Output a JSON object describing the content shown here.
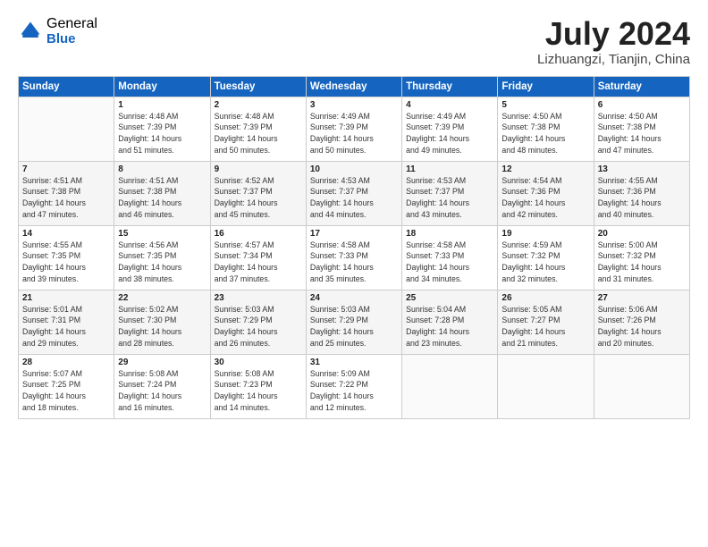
{
  "logo": {
    "general": "General",
    "blue": "Blue"
  },
  "title": "July 2024",
  "subtitle": "Lizhuangzi, Tianjin, China",
  "headers": [
    "Sunday",
    "Monday",
    "Tuesday",
    "Wednesday",
    "Thursday",
    "Friday",
    "Saturday"
  ],
  "weeks": [
    [
      {
        "day": "",
        "info": ""
      },
      {
        "day": "1",
        "info": "Sunrise: 4:48 AM\nSunset: 7:39 PM\nDaylight: 14 hours\nand 51 minutes."
      },
      {
        "day": "2",
        "info": "Sunrise: 4:48 AM\nSunset: 7:39 PM\nDaylight: 14 hours\nand 50 minutes."
      },
      {
        "day": "3",
        "info": "Sunrise: 4:49 AM\nSunset: 7:39 PM\nDaylight: 14 hours\nand 50 minutes."
      },
      {
        "day": "4",
        "info": "Sunrise: 4:49 AM\nSunset: 7:39 PM\nDaylight: 14 hours\nand 49 minutes."
      },
      {
        "day": "5",
        "info": "Sunrise: 4:50 AM\nSunset: 7:38 PM\nDaylight: 14 hours\nand 48 minutes."
      },
      {
        "day": "6",
        "info": "Sunrise: 4:50 AM\nSunset: 7:38 PM\nDaylight: 14 hours\nand 47 minutes."
      }
    ],
    [
      {
        "day": "7",
        "info": "Sunrise: 4:51 AM\nSunset: 7:38 PM\nDaylight: 14 hours\nand 47 minutes."
      },
      {
        "day": "8",
        "info": "Sunrise: 4:51 AM\nSunset: 7:38 PM\nDaylight: 14 hours\nand 46 minutes."
      },
      {
        "day": "9",
        "info": "Sunrise: 4:52 AM\nSunset: 7:37 PM\nDaylight: 14 hours\nand 45 minutes."
      },
      {
        "day": "10",
        "info": "Sunrise: 4:53 AM\nSunset: 7:37 PM\nDaylight: 14 hours\nand 44 minutes."
      },
      {
        "day": "11",
        "info": "Sunrise: 4:53 AM\nSunset: 7:37 PM\nDaylight: 14 hours\nand 43 minutes."
      },
      {
        "day": "12",
        "info": "Sunrise: 4:54 AM\nSunset: 7:36 PM\nDaylight: 14 hours\nand 42 minutes."
      },
      {
        "day": "13",
        "info": "Sunrise: 4:55 AM\nSunset: 7:36 PM\nDaylight: 14 hours\nand 40 minutes."
      }
    ],
    [
      {
        "day": "14",
        "info": "Sunrise: 4:55 AM\nSunset: 7:35 PM\nDaylight: 14 hours\nand 39 minutes."
      },
      {
        "day": "15",
        "info": "Sunrise: 4:56 AM\nSunset: 7:35 PM\nDaylight: 14 hours\nand 38 minutes."
      },
      {
        "day": "16",
        "info": "Sunrise: 4:57 AM\nSunset: 7:34 PM\nDaylight: 14 hours\nand 37 minutes."
      },
      {
        "day": "17",
        "info": "Sunrise: 4:58 AM\nSunset: 7:33 PM\nDaylight: 14 hours\nand 35 minutes."
      },
      {
        "day": "18",
        "info": "Sunrise: 4:58 AM\nSunset: 7:33 PM\nDaylight: 14 hours\nand 34 minutes."
      },
      {
        "day": "19",
        "info": "Sunrise: 4:59 AM\nSunset: 7:32 PM\nDaylight: 14 hours\nand 32 minutes."
      },
      {
        "day": "20",
        "info": "Sunrise: 5:00 AM\nSunset: 7:32 PM\nDaylight: 14 hours\nand 31 minutes."
      }
    ],
    [
      {
        "day": "21",
        "info": "Sunrise: 5:01 AM\nSunset: 7:31 PM\nDaylight: 14 hours\nand 29 minutes."
      },
      {
        "day": "22",
        "info": "Sunrise: 5:02 AM\nSunset: 7:30 PM\nDaylight: 14 hours\nand 28 minutes."
      },
      {
        "day": "23",
        "info": "Sunrise: 5:03 AM\nSunset: 7:29 PM\nDaylight: 14 hours\nand 26 minutes."
      },
      {
        "day": "24",
        "info": "Sunrise: 5:03 AM\nSunset: 7:29 PM\nDaylight: 14 hours\nand 25 minutes."
      },
      {
        "day": "25",
        "info": "Sunrise: 5:04 AM\nSunset: 7:28 PM\nDaylight: 14 hours\nand 23 minutes."
      },
      {
        "day": "26",
        "info": "Sunrise: 5:05 AM\nSunset: 7:27 PM\nDaylight: 14 hours\nand 21 minutes."
      },
      {
        "day": "27",
        "info": "Sunrise: 5:06 AM\nSunset: 7:26 PM\nDaylight: 14 hours\nand 20 minutes."
      }
    ],
    [
      {
        "day": "28",
        "info": "Sunrise: 5:07 AM\nSunset: 7:25 PM\nDaylight: 14 hours\nand 18 minutes."
      },
      {
        "day": "29",
        "info": "Sunrise: 5:08 AM\nSunset: 7:24 PM\nDaylight: 14 hours\nand 16 minutes."
      },
      {
        "day": "30",
        "info": "Sunrise: 5:08 AM\nSunset: 7:23 PM\nDaylight: 14 hours\nand 14 minutes."
      },
      {
        "day": "31",
        "info": "Sunrise: 5:09 AM\nSunset: 7:22 PM\nDaylight: 14 hours\nand 12 minutes."
      },
      {
        "day": "",
        "info": ""
      },
      {
        "day": "",
        "info": ""
      },
      {
        "day": "",
        "info": ""
      }
    ]
  ]
}
